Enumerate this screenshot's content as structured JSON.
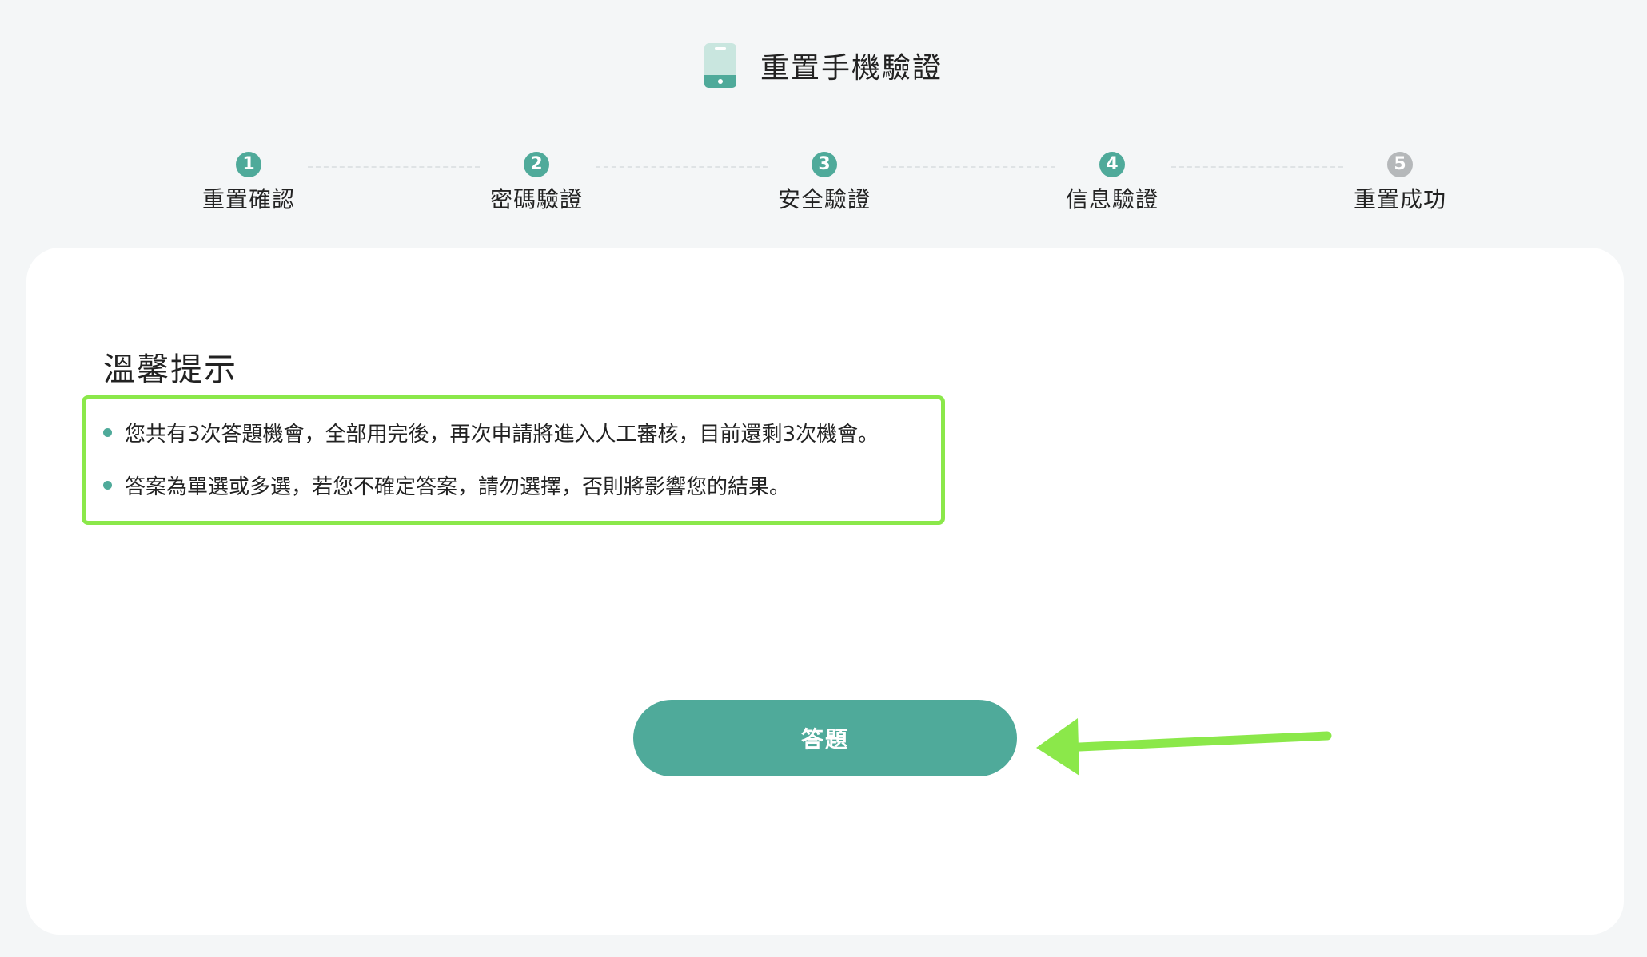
{
  "header": {
    "title": "重置手機驗證",
    "icon": "phone-icon",
    "icon_color": "#4faa9a"
  },
  "stepper": {
    "active_color": "#4faa9a",
    "pending_color": "#b5b8ba",
    "steps": [
      {
        "number": "1",
        "label": "重置確認",
        "status": "done"
      },
      {
        "number": "2",
        "label": "密碼驗證",
        "status": "done"
      },
      {
        "number": "3",
        "label": "安全驗證",
        "status": "done"
      },
      {
        "number": "4",
        "label": "信息驗證",
        "status": "done"
      },
      {
        "number": "5",
        "label": "重置成功",
        "status": "pending"
      }
    ]
  },
  "tips": {
    "title": "溫馨提示",
    "items": [
      "您共有3次答題機會，全部用完後，再次申請將進入人工審核，目前還剩3次機會。",
      "答案為單選或多選，若您不確定答案，請勿選擇，否則將影響您的結果。"
    ],
    "highlight_color": "#8be84a"
  },
  "actions": {
    "answer_label": "答題",
    "button_color": "#4faa9a"
  },
  "annotation": {
    "icon": "arrow-left-icon",
    "color": "#8be84a"
  }
}
